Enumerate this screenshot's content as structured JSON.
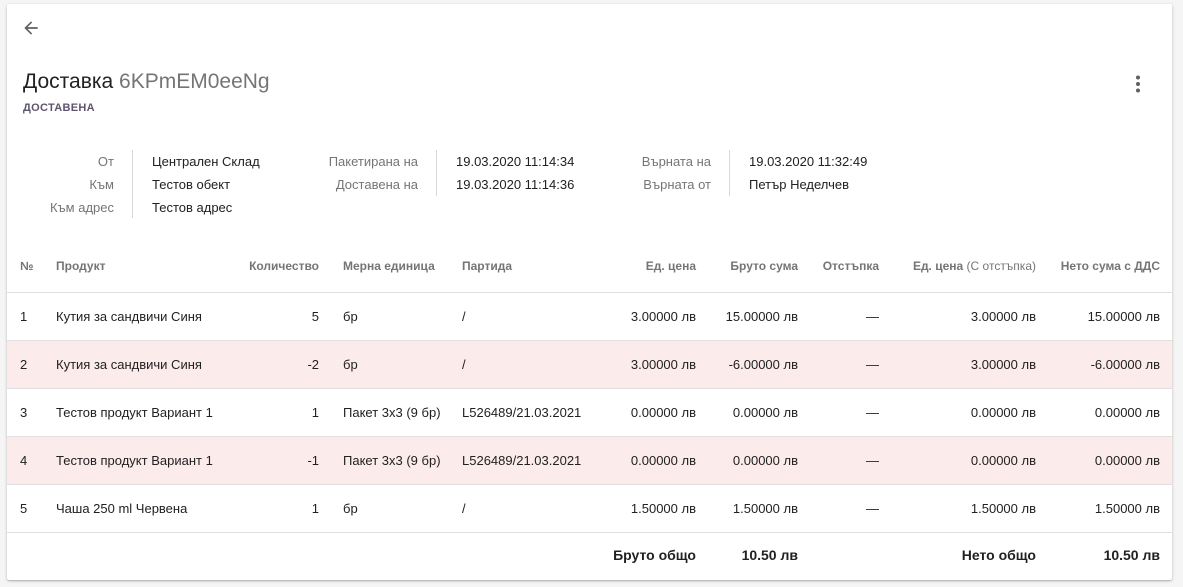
{
  "header": {
    "title": "Доставка",
    "code": "6KPmEM0eeNg",
    "status": "ДОСТАВЕНА"
  },
  "info": {
    "col1": [
      {
        "label": "От",
        "value": "Централен Склад"
      },
      {
        "label": "Към",
        "value": "Тестов обект"
      },
      {
        "label": "Към адрес",
        "value": "Тестов адрес"
      }
    ],
    "col2": [
      {
        "label": "Пакетирана на",
        "value": "19.03.2020 11:14:34"
      },
      {
        "label": "Доставена на",
        "value": "19.03.2020 11:14:36"
      }
    ],
    "col3": [
      {
        "label": "Върната на",
        "value": "19.03.2020 11:32:49"
      },
      {
        "label": "Върната от",
        "value": "Петър Неделчев"
      }
    ]
  },
  "table": {
    "headers": {
      "num": "№",
      "product": "Продукт",
      "qty": "Количество",
      "unit": "Мерна единица",
      "batch": "Партида",
      "price": "Ед. цена",
      "gross": "Бруто сума",
      "discount": "Отстъпка",
      "price_disc": "Ед. цена",
      "price_disc_sub": "(С отстъпка)",
      "net": "Нето сума с ДДС"
    },
    "rows": [
      {
        "num": "1",
        "product": "Кутия за сандвичи Синя",
        "qty": "5",
        "unit": "бр",
        "batch": "/",
        "price": "3.00000 лв",
        "gross": "15.00000 лв",
        "discount": "—",
        "price_disc": "3.00000 лв",
        "net": "15.00000 лв"
      },
      {
        "num": "2",
        "product": "Кутия за сандвичи Синя",
        "qty": "-2",
        "unit": "бр",
        "batch": "/",
        "price": "3.00000 лв",
        "gross": "-6.00000 лв",
        "discount": "—",
        "price_disc": "3.00000 лв",
        "net": "-6.00000 лв"
      },
      {
        "num": "3",
        "product": "Тестов продукт Вариант 1",
        "qty": "1",
        "unit": "Пакет 3x3 (9 бр)",
        "batch": "L526489/21.03.2021",
        "price": "0.00000 лв",
        "gross": "0.00000 лв",
        "discount": "—",
        "price_disc": "0.00000 лв",
        "net": "0.00000 лв"
      },
      {
        "num": "4",
        "product": "Тестов продукт Вариант 1",
        "qty": "-1",
        "unit": "Пакет 3x3 (9 бр)",
        "batch": "L526489/21.03.2021",
        "price": "0.00000 лв",
        "gross": "0.00000 лв",
        "discount": "—",
        "price_disc": "0.00000 лв",
        "net": "0.00000 лв"
      },
      {
        "num": "5",
        "product": "Чаша 250 ml Червена",
        "qty": "1",
        "unit": "бр",
        "batch": "/",
        "price": "1.50000 лв",
        "gross": "1.50000 лв",
        "discount": "—",
        "price_disc": "1.50000 лв",
        "net": "1.50000 лв"
      }
    ],
    "totals": {
      "gross_label": "Бруто общо",
      "gross_value": "10.50 лв",
      "net_label": "Нето общо",
      "net_value": "10.50 лв"
    }
  },
  "colors": {
    "negative_row_bg": "#fcebeb",
    "status": "#5e5470"
  },
  "icons": {
    "back": "arrow-left-icon",
    "menu": "more-vertical-icon"
  }
}
